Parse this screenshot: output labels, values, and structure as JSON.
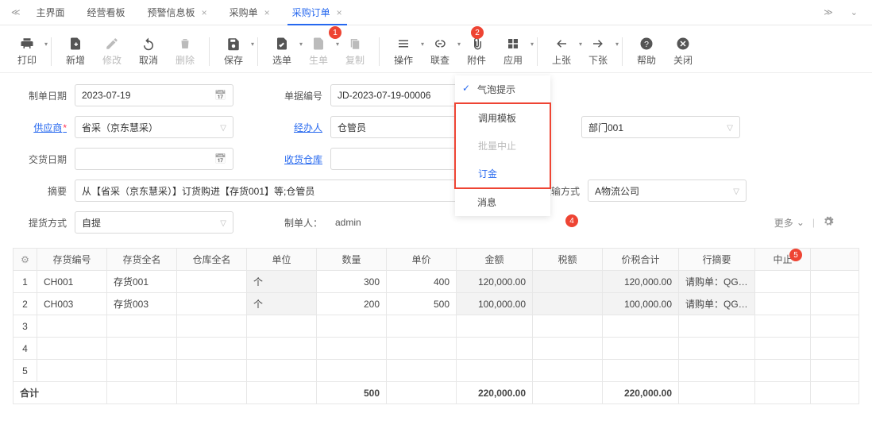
{
  "tabs": {
    "items": [
      {
        "label": "主界面",
        "closable": false
      },
      {
        "label": "经营看板",
        "closable": false
      },
      {
        "label": "预警信息板",
        "closable": true
      },
      {
        "label": "采购单",
        "closable": true
      },
      {
        "label": "采购订单",
        "closable": true,
        "active": true
      }
    ]
  },
  "toolbar": {
    "print": "打印",
    "add": "新增",
    "modify": "修改",
    "cancel": "取消",
    "delete": "删除",
    "save": "保存",
    "select": "选单",
    "generate": "生单",
    "copy": "复制",
    "operate": "操作",
    "link": "联查",
    "attach": "附件",
    "app": "应用",
    "prev": "上张",
    "next": "下张",
    "help": "帮助",
    "close": "关闭"
  },
  "menu": {
    "bubble_tip": "气泡提示",
    "call_template": "调用模板",
    "batch_abort": "批量中止",
    "deposit": "订金",
    "message": "消息"
  },
  "form": {
    "make_date_label": "制单日期",
    "make_date": "2023-07-19",
    "doc_no_label": "单据编号",
    "doc_no": "JD-2023-07-19-00006",
    "supplier_label": "供应商",
    "supplier": "省采（京东慧采）",
    "handler_label": "经办人",
    "handler": "仓管员",
    "dept": "部门001",
    "delivery_date_label": "交货日期",
    "recv_wh_label": "收货仓库",
    "transport_label": "运输方式",
    "transport": "A物流公司",
    "summary_label": "摘要",
    "summary": "从【省采（京东慧采）】订货购进【存货001】等;仓管员",
    "pickup_label": "提货方式",
    "pickup": "自提",
    "maker_label": "制单人：",
    "maker": "admin",
    "more": "更多"
  },
  "table": {
    "headers": {
      "inv_no": "存货编号",
      "inv_name": "存货全名",
      "wh_name": "仓库全名",
      "unit": "单位",
      "qty": "数量",
      "price": "单价",
      "amount": "金额",
      "tax": "税额",
      "total": "价税合计",
      "row_summary": "行摘要",
      "abort": "中止"
    },
    "rows": [
      {
        "idx": "1",
        "inv_no": "CH001",
        "inv_name": "存货001",
        "unit": "个",
        "qty": "300",
        "price": "400",
        "amount": "120,000.00",
        "total": "120,000.00",
        "row_summary": "请购单：QG…"
      },
      {
        "idx": "2",
        "inv_no": "CH003",
        "inv_name": "存货003",
        "unit": "个",
        "qty": "200",
        "price": "500",
        "amount": "100,000.00",
        "total": "100,000.00",
        "row_summary": "请购单：QG…"
      },
      {
        "idx": "3"
      },
      {
        "idx": "4"
      },
      {
        "idx": "5"
      }
    ],
    "footer": {
      "label": "合计",
      "qty": "500",
      "amount": "220,000.00",
      "total": "220,000.00"
    }
  },
  "badges": {
    "b1": "1",
    "b2": "2",
    "b4": "4",
    "b5": "5"
  }
}
